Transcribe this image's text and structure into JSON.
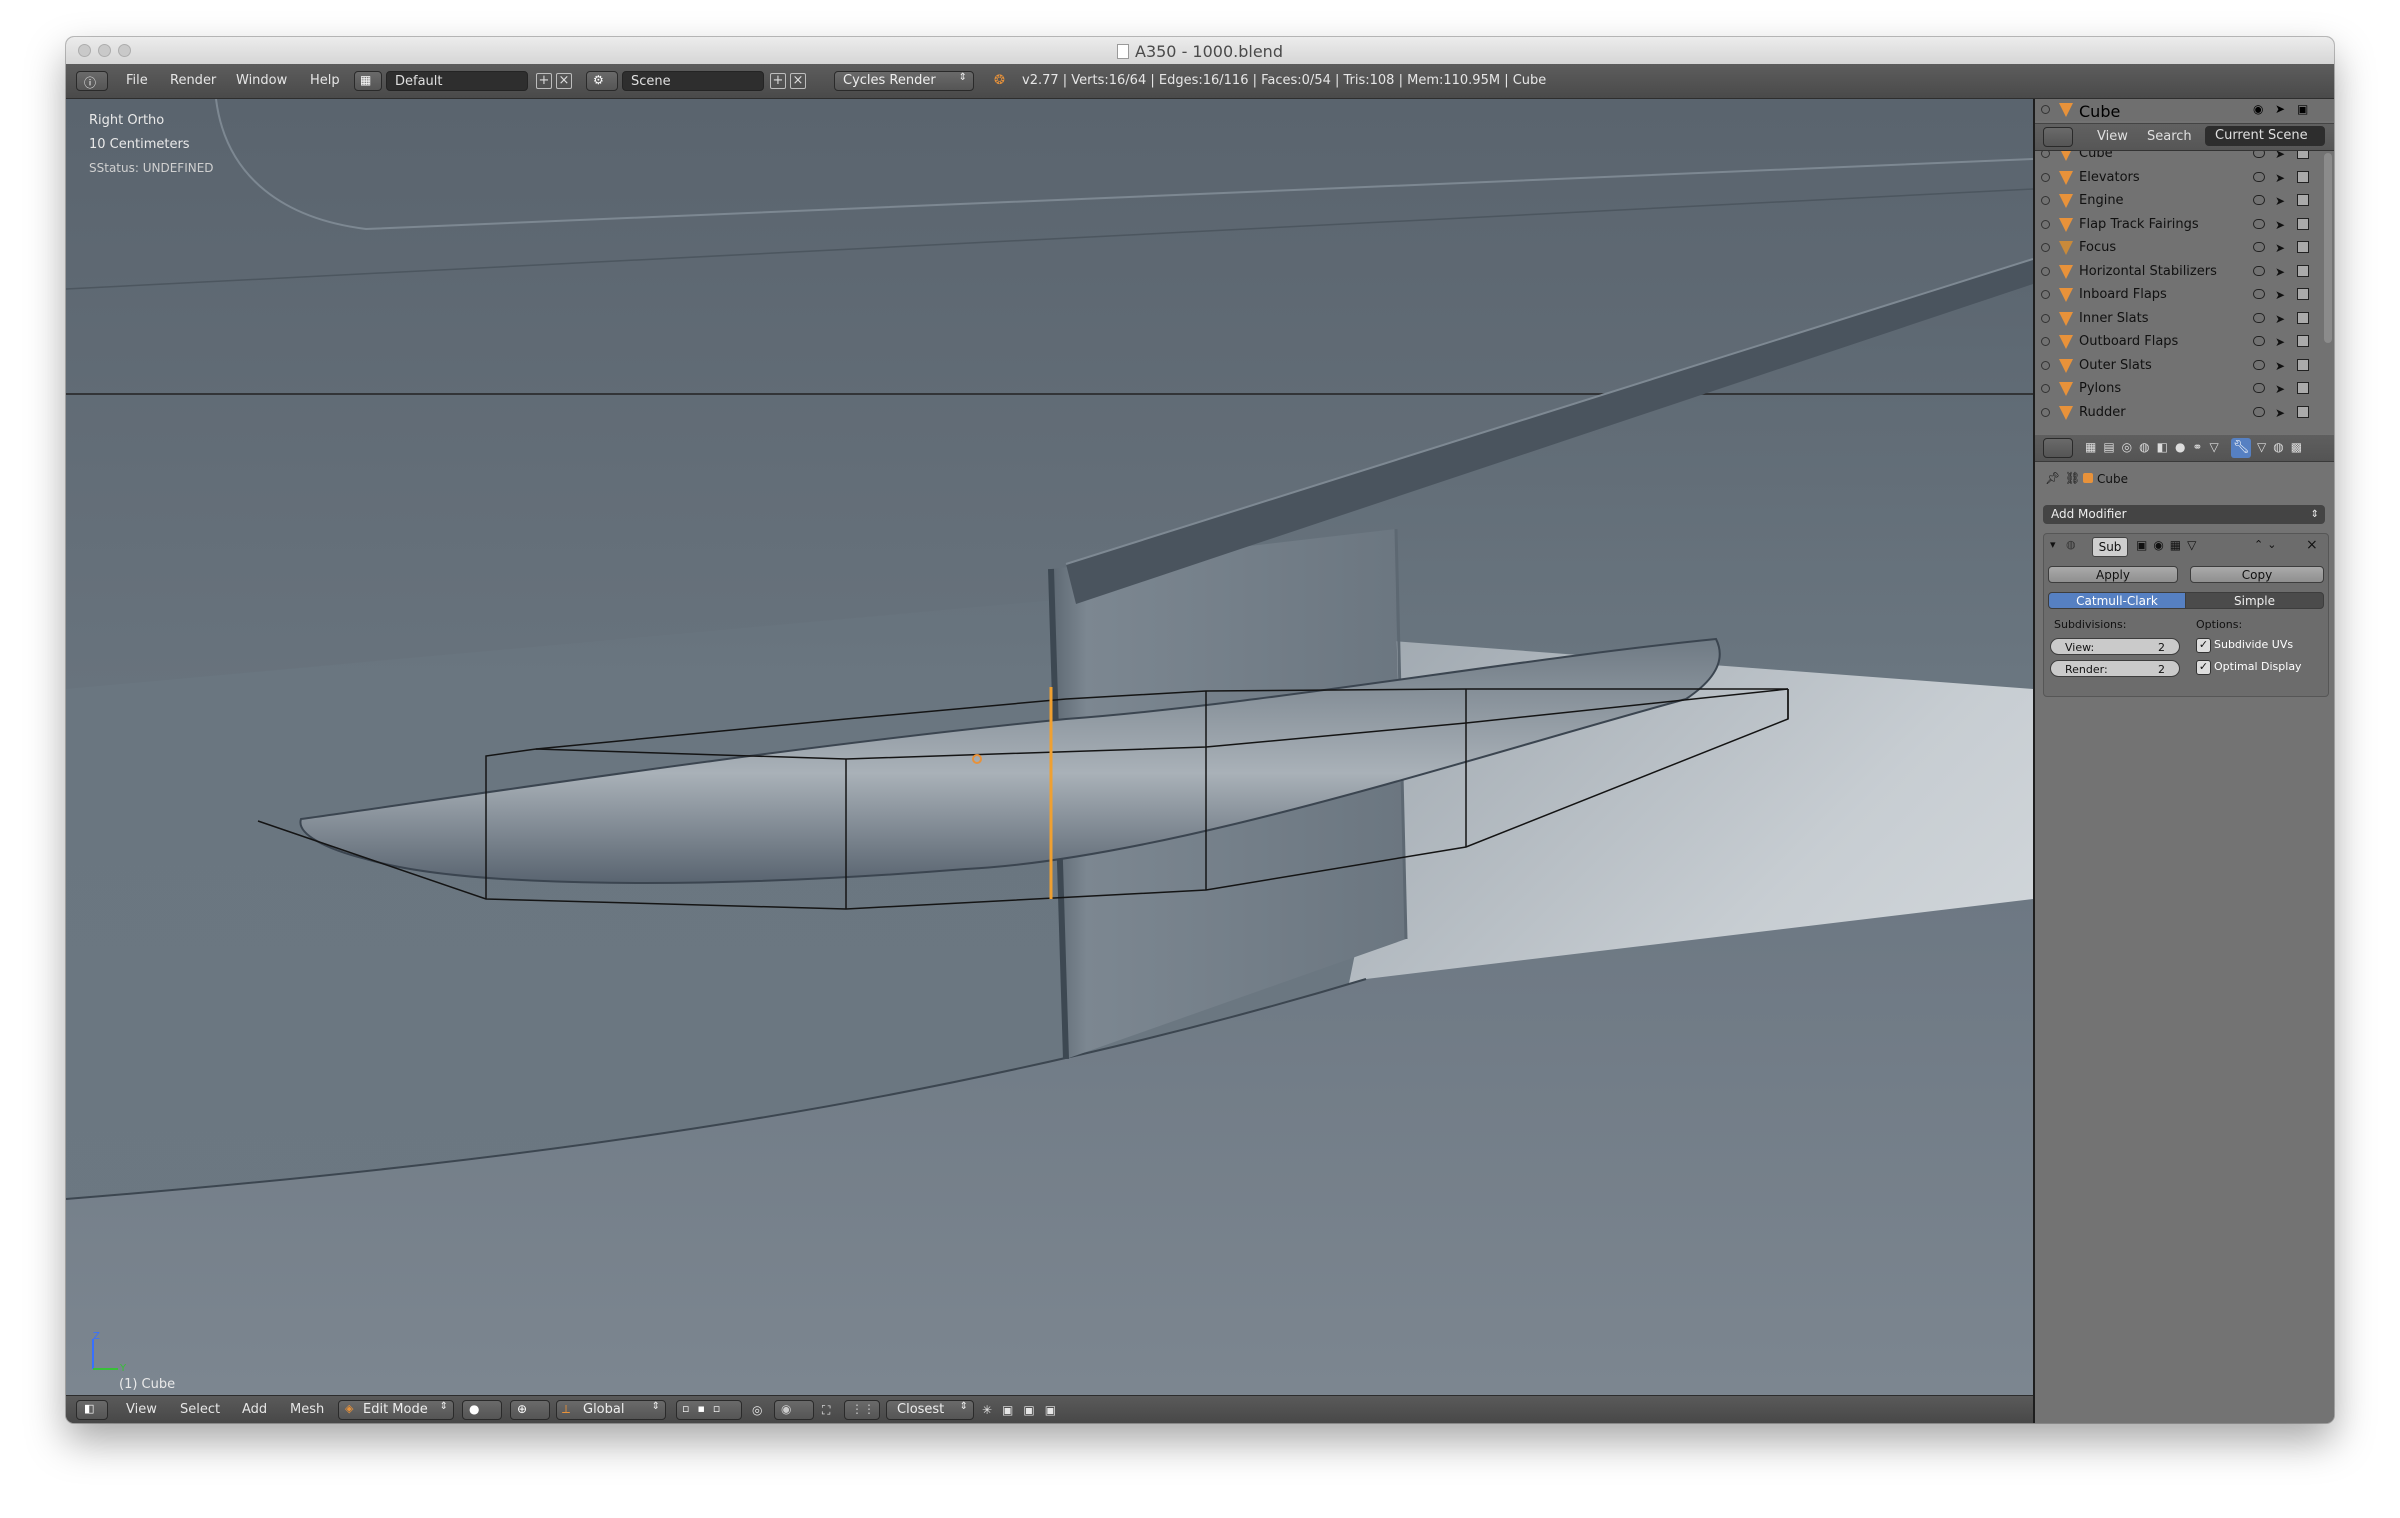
{
  "window": {
    "title": "A350 - 1000.blend"
  },
  "topbar": {
    "menus": [
      "File",
      "Render",
      "Window",
      "Help"
    ],
    "layout": "Default",
    "scene": "Scene",
    "engine": "Cycles Render",
    "stats": "v2.77 | Verts:16/64 | Edges:16/116 | Faces:0/54 | Tris:108 | Mem:110.95M | Cube"
  },
  "viewport": {
    "view_name": "Right Ortho",
    "scale": "10 Centimeters",
    "status": "SStatus: UNDEFINED",
    "object_label": "(1) Cube",
    "axis_z": "Z",
    "axis_y": "Y"
  },
  "outliner": {
    "header_object": "Cube",
    "tabs": [
      "View",
      "Search",
      "Current Scene"
    ],
    "items": [
      "Cube",
      "Elevators",
      "Engine",
      "Flap Track Fairings",
      "Focus",
      "Horizontal Stabilizers",
      "Inboard Flaps",
      "Inner Slats",
      "Outboard Flaps",
      "Outer Slats",
      "Pylons",
      "Rudder"
    ]
  },
  "properties": {
    "breadcrumb": "Cube",
    "add_modifier": "Add Modifier",
    "modifier_name": "Sub",
    "apply": "Apply",
    "copy": "Copy",
    "mode_active": "Catmull-Clark",
    "mode_inactive": "Simple",
    "subdivisions_label": "Subdivisions:",
    "options_label": "Options:",
    "view_label": "View:",
    "view_value": "2",
    "render_label": "Render:",
    "render_value": "2",
    "opt_uvs": "Subdivide UVs",
    "opt_display": "Optimal Display"
  },
  "bottombar": {
    "menus": [
      "View",
      "Select",
      "Add",
      "Mesh"
    ],
    "mode": "Edit Mode",
    "orientation": "Global",
    "snap": "Closest"
  },
  "colors": {
    "accent": "#e8923a",
    "active_blue": "#5680c2",
    "selected_edge": "#f0a030"
  }
}
